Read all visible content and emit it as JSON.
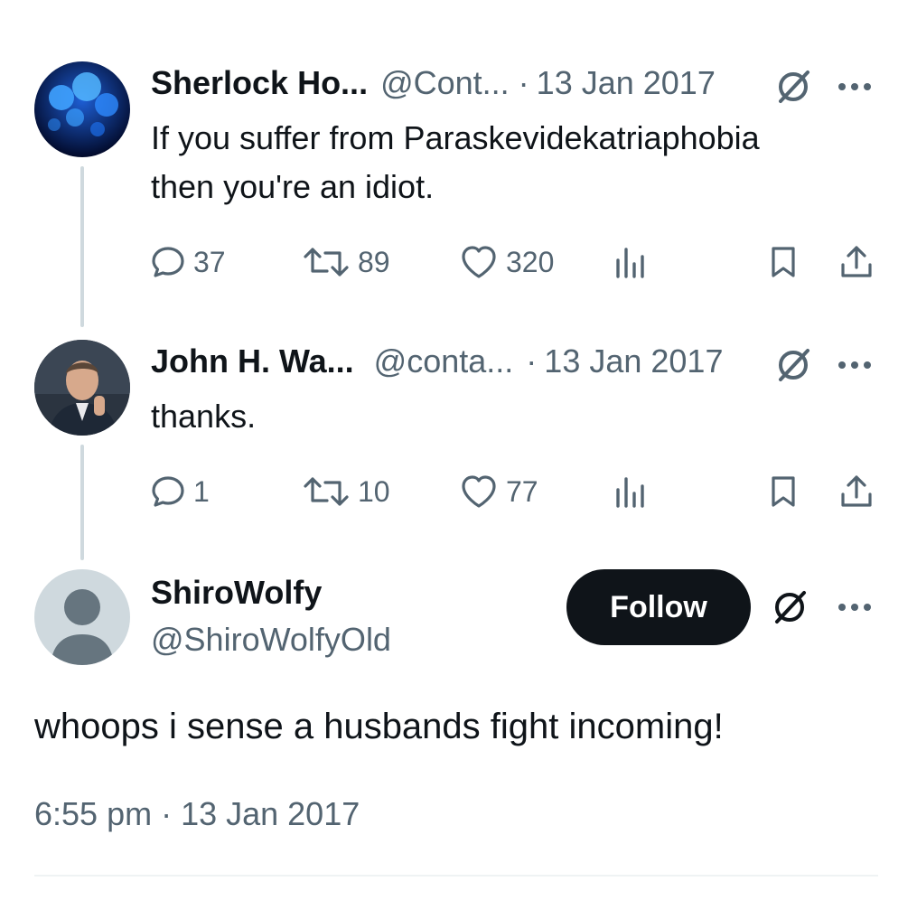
{
  "colors": {
    "text": "#0f1419",
    "muted": "#536471",
    "thread_line": "#cfd9de",
    "follow_bg": "#0f1419",
    "follow_text": "#ffffff"
  },
  "tweets": [
    {
      "display_name": "Sherlock Ho...",
      "handle": "@Cont...",
      "separator": "·",
      "date": "13 Jan 2017",
      "text_line1": "If you suffer from Paraskevidekatriaphobia",
      "text_line2": "then you're an idiot.",
      "replies": "37",
      "retweets": "89",
      "likes": "320"
    },
    {
      "display_name": "John H. Wa...",
      "handle": "@conta...",
      "separator": "·",
      "date": "13 Jan 2017",
      "text_line1": "thanks.",
      "replies": "1",
      "retweets": "10",
      "likes": "77"
    }
  ],
  "main_tweet": {
    "display_name": "ShiroWolfy",
    "handle": "@ShiroWolfyOld",
    "follow_label": "Follow",
    "text": "whoops i sense a husbands fight incoming!",
    "timestamp": "6:55 pm · 13 Jan 2017"
  },
  "icons": {
    "reply": "reply-bubble-icon",
    "retweet": "retweet-icon",
    "like": "heart-icon",
    "views": "views-bars-icon",
    "bookmark": "bookmark-icon",
    "share": "share-icon",
    "grok": "slashed-circle-icon",
    "more": "more-dots-icon"
  }
}
